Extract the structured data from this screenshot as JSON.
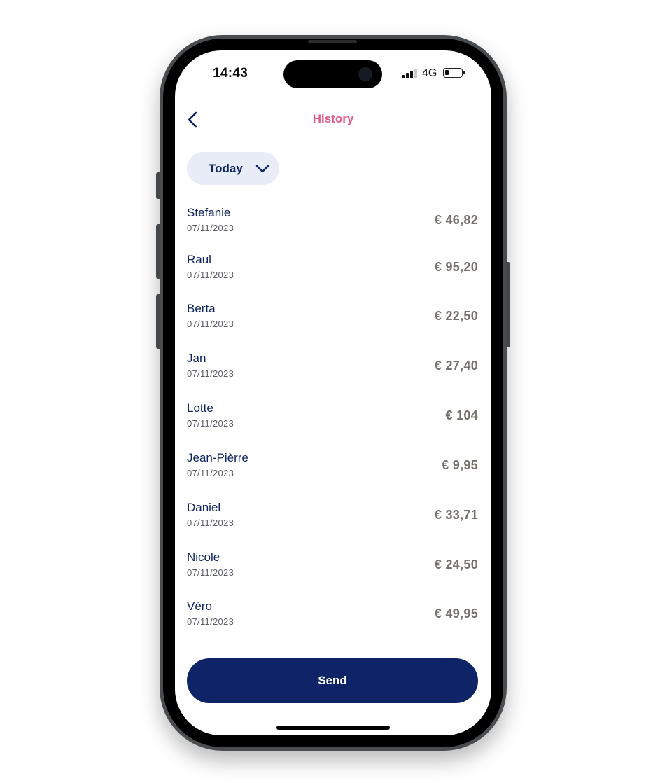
{
  "status_bar": {
    "time": "14:43",
    "network": "4G",
    "signal_icon": "signal-bars-icon",
    "battery_icon": "battery-icon"
  },
  "header": {
    "back_icon": "chevron-left-icon",
    "title": "History"
  },
  "filter": {
    "selected": "Today",
    "icon": "chevron-down-icon"
  },
  "transactions": [
    {
      "name": "Stefanie",
      "date": "07/11/2023",
      "amount": "€ 46,82"
    },
    {
      "name": "Raul",
      "date": "07/11/2023",
      "amount": "€ 95,20"
    },
    {
      "name": "Berta",
      "date": "07/11/2023",
      "amount": "€ 22,50"
    },
    {
      "name": "Jan",
      "date": "07/11/2023",
      "amount": "€ 27,40"
    },
    {
      "name": "Lotte",
      "date": "07/11/2023",
      "amount": "€ 104"
    },
    {
      "name": "Jean-Pièrre",
      "date": "07/11/2023",
      "amount": "€ 9,95"
    },
    {
      "name": "Daniel",
      "date": "07/11/2023",
      "amount": "€ 33,71"
    },
    {
      "name": "Nicole",
      "date": "07/11/2023",
      "amount": "€ 24,50"
    },
    {
      "name": "Véro",
      "date": "07/11/2023",
      "amount": "€ 49,95"
    }
  ],
  "actions": {
    "send_label": "Send"
  },
  "colors": {
    "accent_pink": "#e05a86",
    "navy": "#0e2466",
    "filter_bg": "#e8ecf7",
    "amount_gray": "#75726e"
  }
}
